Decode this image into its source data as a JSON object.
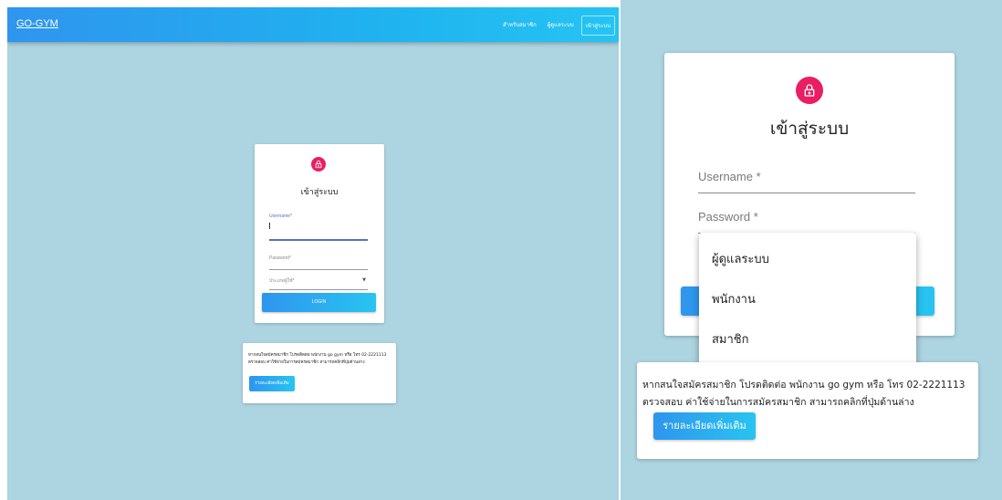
{
  "navbar": {
    "brand": "GO-GYM",
    "links": [
      "สำหรับสมาชิก",
      "ผู้ดูแลระบบ",
      "เข้าสู่ระบบ"
    ]
  },
  "login": {
    "title": "เข้าสู่ระบบ",
    "username_label": "Username*",
    "password_label": "Password*",
    "usertype_label": "ประเภทผู้ใช้*",
    "login_button": "LOGIN"
  },
  "zoom": {
    "username_label": "Username *",
    "password_label": "Password *"
  },
  "usertype_options": [
    "ผู้ดูแลระบบ",
    "พนักงาน",
    "สมาชิก"
  ],
  "info": {
    "line1": "หากสนใจสมัครสมาชิก โปรดติดต่อ พนักงาน go gym หรือ โทร 02-2221113",
    "line2": "ตรวจสอบ ค่าใช้จ่ายในการสมัครสมาชิก สามารถคลิกที่ปุ่มด้านล่าง",
    "button": "รายละเอียดเพิ่มเติม"
  },
  "colors": {
    "background": "#acd4e1",
    "accent": "#e91e63",
    "primary_gradient_start": "#2f95ee",
    "primary_gradient_end": "#28c4f0"
  }
}
